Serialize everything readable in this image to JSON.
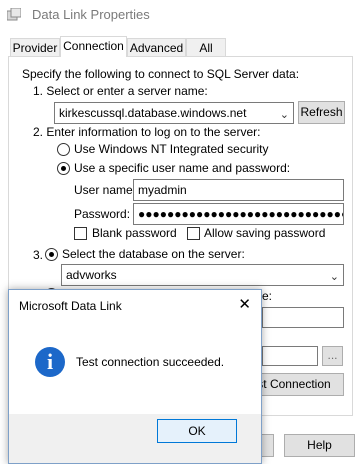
{
  "window": {
    "title": "Data Link Properties"
  },
  "tabs": [
    {
      "label": "Provider"
    },
    {
      "label": "Connection"
    },
    {
      "label": "Advanced"
    },
    {
      "label": "All"
    }
  ],
  "connection": {
    "intro": "Specify the following to connect to SQL Server data:",
    "step1_label": "1. Select or enter a server name:",
    "server_value": "kirkescussql.database.windows.net",
    "refresh_label": "Refresh",
    "step2_label": "2. Enter information to log on to the server:",
    "option_integrated": "Use Windows NT Integrated security",
    "option_specific": "Use a specific user name and password:",
    "username_label": "User name:",
    "username_value": "myadmin",
    "password_label": "Password:",
    "password_value": "●●●●●●●●●●●●●●●●●●●●●●●●●●●●●●●●●●●",
    "blank_password_label": "Blank password",
    "allow_saving_label": "Allow saving password",
    "step3_label": "3.",
    "select_db_label": "Select the database on the server:",
    "database_value": "advworks",
    "partial_label_fragment": "e:",
    "test_connection_fragment": "st Connection",
    "browse_label": "..."
  },
  "footer": {
    "help_label": "Help"
  },
  "dialog": {
    "title": "Microsoft Data Link",
    "message": "Test connection succeeded.",
    "ok_label": "OK",
    "close_glyph": "✕",
    "info_glyph": "i"
  },
  "colors": {
    "dialog_border": "#7ea0c8",
    "info_blue": "#1c68c9",
    "ok_border": "#0078d7"
  }
}
